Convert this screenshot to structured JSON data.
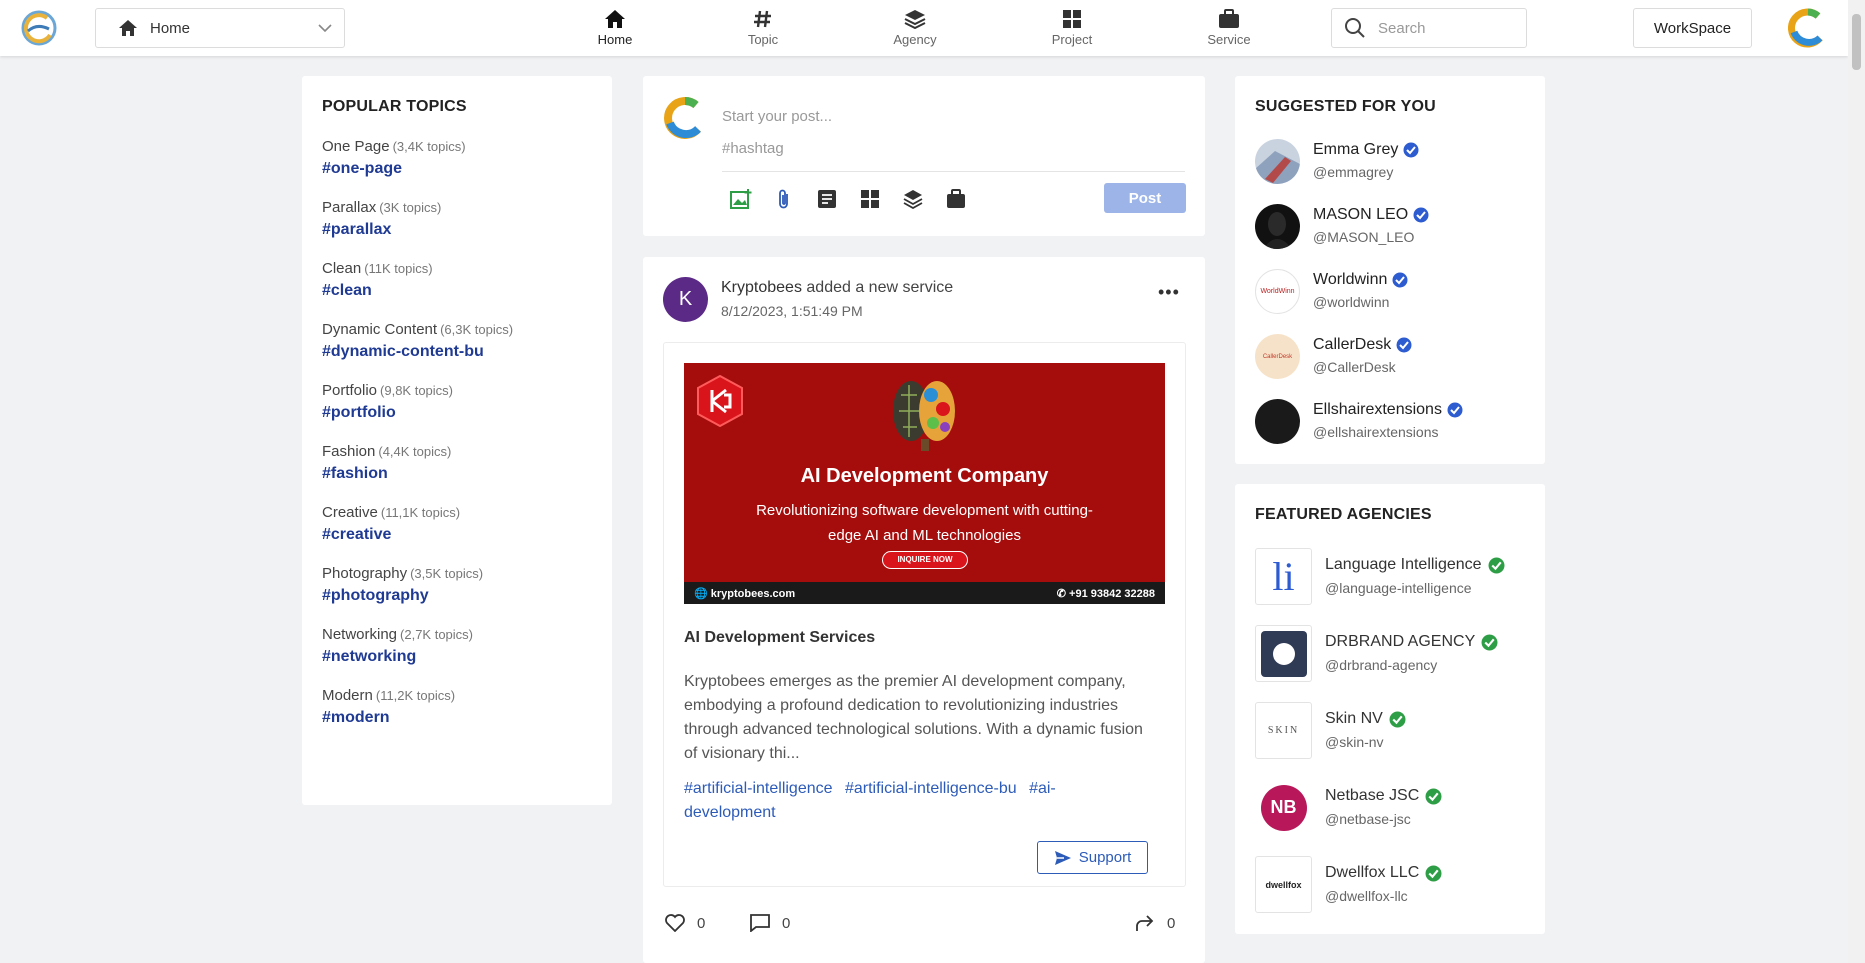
{
  "header": {
    "home_select": "Home",
    "nav": [
      {
        "label": "Home",
        "icon": "home-icon"
      },
      {
        "label": "Topic",
        "icon": "hashtag-icon"
      },
      {
        "label": "Agency",
        "icon": "layers-icon"
      },
      {
        "label": "Project",
        "icon": "grid-icon"
      },
      {
        "label": "Service",
        "icon": "briefcase-icon"
      }
    ],
    "search_placeholder": "Search",
    "workspace": "WorkSpace"
  },
  "popular_topics": {
    "title": "POPULAR TOPICS",
    "items": [
      {
        "name": "One Page",
        "count": "(3,4K topics)",
        "tag": "#one-page"
      },
      {
        "name": "Parallax",
        "count": "(3K topics)",
        "tag": "#parallax"
      },
      {
        "name": "Clean",
        "count": "(11K topics)",
        "tag": "#clean"
      },
      {
        "name": "Dynamic Content",
        "count": "(6,3K topics)",
        "tag": "#dynamic-content-bu"
      },
      {
        "name": "Portfolio",
        "count": "(9,8K topics)",
        "tag": "#portfolio"
      },
      {
        "name": "Fashion",
        "count": "(4,4K topics)",
        "tag": "#fashion"
      },
      {
        "name": "Creative",
        "count": "(11,1K topics)",
        "tag": "#creative"
      },
      {
        "name": "Photography",
        "count": "(3,5K topics)",
        "tag": "#photography"
      },
      {
        "name": "Networking",
        "count": "(2,7K topics)",
        "tag": "#networking"
      },
      {
        "name": "Modern",
        "count": "(11,2K topics)",
        "tag": "#modern"
      }
    ]
  },
  "composer": {
    "placeholder_post": "Start your post...",
    "placeholder_hashtag": "#hashtag",
    "post_button": "Post"
  },
  "post": {
    "avatar_letter": "K",
    "author": "Kryptobees",
    "action": "added a new service",
    "time": "8/12/2023, 1:51:49 PM",
    "more": "•••",
    "banner": {
      "heading": "AI Development Company",
      "subheading": "Revolutionizing software development with cutting-edge AI and ML technologies",
      "cta": "INQUIRE NOW",
      "site": "kryptobees.com",
      "phone": "+91 93842 32288"
    },
    "service_title": "AI Development Services",
    "description": "Kryptobees emerges as the premier AI development company, embodying a profound dedication to revolutionizing industries through advanced technological solutions. With a dynamic fusion of visionary thi...",
    "tags": [
      "#artificial-intelligence",
      "#artificial-intelligence-bu",
      "#ai-development"
    ],
    "support_button": "Support",
    "likes": "0",
    "comments": "0",
    "shares": "0"
  },
  "suggested": {
    "title": "SUGGESTED FOR YOU",
    "people": [
      {
        "name": "Emma Grey",
        "handle": "@emmagrey"
      },
      {
        "name": "MASON LEO",
        "handle": "@MASON_LEO"
      },
      {
        "name": "Worldwinn",
        "handle": "@worldwinn",
        "logo_text": "WorldWinn"
      },
      {
        "name": "CallerDesk",
        "handle": "@CallerDesk",
        "logo_text": "CallerDesk"
      },
      {
        "name": "Ellshairextensions",
        "handle": "@ellshairextensions"
      }
    ]
  },
  "agencies": {
    "title": "FEATURED AGENCIES",
    "items": [
      {
        "name": "Language Intelligence",
        "handle": "@language-intelligence",
        "logo_text": "li"
      },
      {
        "name": "DRBRAND AGENCY",
        "handle": "@drbrand-agency"
      },
      {
        "name": "Skin NV",
        "handle": "@skin-nv",
        "logo_text": "SKIN"
      },
      {
        "name": "Netbase JSC",
        "handle": "@netbase-jsc",
        "logo_text": "NB"
      },
      {
        "name": "Dwellfox LLC",
        "handle": "@dwellfox-llc",
        "logo_text": "dwellfox"
      }
    ]
  },
  "colors": {
    "accent": "#1f3a93",
    "link": "#2d5bb8",
    "verified_blue": "#2d5bd0",
    "verified_green": "#2e9e46",
    "post_button": "#9db4e8",
    "banner_red": "#a50d0d"
  }
}
